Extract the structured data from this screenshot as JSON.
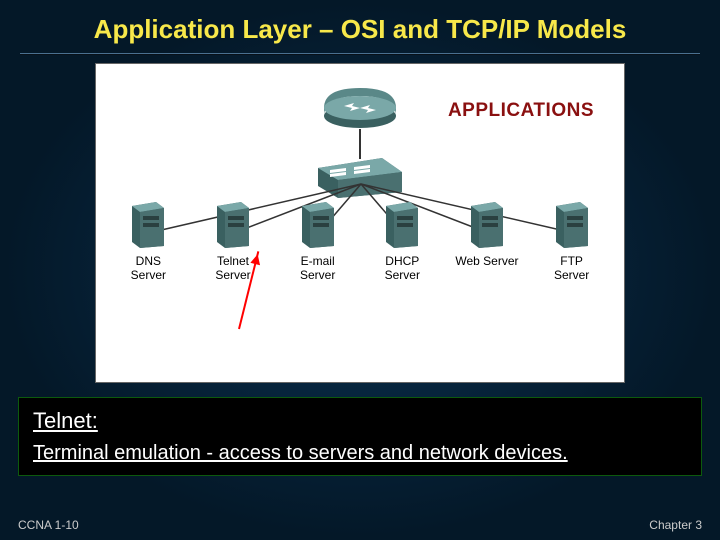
{
  "title": "Application Layer – OSI and TCP/IP Models",
  "diagram": {
    "heading": "APPLICATIONS",
    "servers": [
      {
        "line1": "DNS",
        "line2": "Server"
      },
      {
        "line1": "Telnet",
        "line2": "Server"
      },
      {
        "line1": "E-mail",
        "line2": "Server"
      },
      {
        "line1": "DHCP",
        "line2": "Server"
      },
      {
        "line1": "Web Server",
        "line2": ""
      },
      {
        "line1": "FTP",
        "line2": "Server"
      }
    ]
  },
  "callout": {
    "title": "Telnet:",
    "body": "Terminal emulation - access to servers and network devices."
  },
  "footer": {
    "left": "CCNA 1-10",
    "right": "Chapter 3"
  }
}
